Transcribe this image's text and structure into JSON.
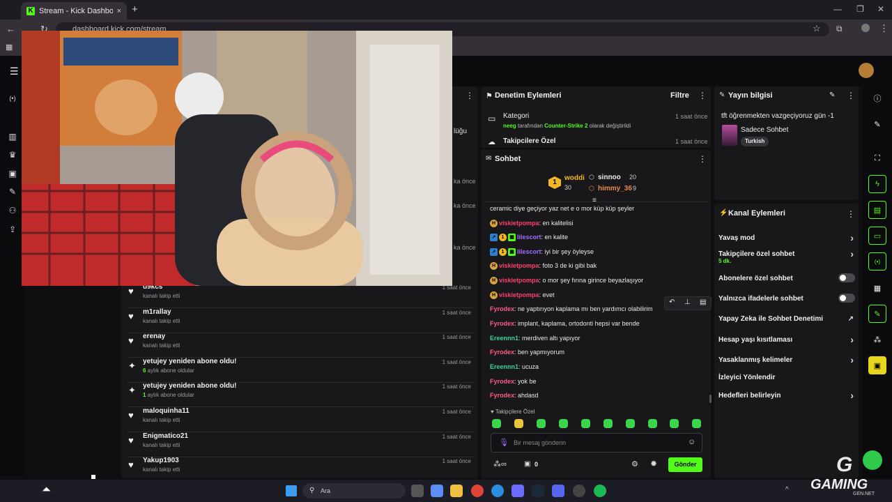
{
  "browser": {
    "tab_title": "Stream - Kick Dashboard",
    "url": "dashboard.kick.com/stream",
    "new_tab": "+",
    "tab_close": "×",
    "favicon": "K"
  },
  "left_partial": {
    "hidden_text": "lüğu",
    "times": [
      "ka önce",
      "ka önce",
      "ka önce"
    ]
  },
  "activity": [
    {
      "icon": "heart-icon",
      "glyph": "♥",
      "name": "u9kcs",
      "desc": "kanalı takip etti",
      "time": "1 saat önce"
    },
    {
      "icon": "heart-icon",
      "glyph": "♥",
      "name": "m1rallay",
      "desc": "kanalı takip etti",
      "time": "1 saat önce"
    },
    {
      "icon": "heart-icon",
      "glyph": "♥",
      "name": "erenay",
      "desc": "kanalı takip etti",
      "time": "1 saat önce"
    },
    {
      "icon": "sparkle-icon",
      "glyph": "✦",
      "name": "yetujey yeniden abone oldu!",
      "desc_num": "6",
      "desc": " aylık abone oldular",
      "time": "1 saat önce"
    },
    {
      "icon": "sparkle-icon",
      "glyph": "✦",
      "name": "yetujey yeniden abone oldu!",
      "desc_num": "1",
      "desc": " aylık abone oldular",
      "time": "1 saat önce"
    },
    {
      "icon": "heart-icon",
      "glyph": "♥",
      "name": "maloquinha11",
      "desc": "kanalı takip etti",
      "time": "1 saat önce"
    },
    {
      "icon": "heart-icon",
      "glyph": "♥",
      "name": "Enigmatico21",
      "desc": "kanalı takip etti",
      "time": "1 saat önce"
    },
    {
      "icon": "heart-icon",
      "glyph": "♥",
      "name": "Yakup1903",
      "desc": "kanalı takip etti",
      "time": "1 saat önce"
    }
  ],
  "moderation": {
    "title": "Denetim Eylemleri",
    "filter": "Filtre",
    "items": [
      {
        "title": "Kategori",
        "user": "neeg",
        "mid": " tarafından ",
        "cat": "Counter-Strike 2",
        "end": " olarak değiştirildi",
        "time": "1 saat önce"
      },
      {
        "title": "Takipcilere Özel",
        "time": "1 saat önce"
      }
    ]
  },
  "chat": {
    "title": "Sohbet",
    "leaderboard": [
      {
        "rank": "1",
        "name": "woddi",
        "count": "30"
      },
      {
        "name": "sinnoo",
        "count": "20"
      },
      {
        "name": "himmy_36",
        "count": "9"
      }
    ],
    "messages": [
      {
        "user": "",
        "text": "ceramic diye geçiyor yaz net e o mor küp küp şeyler",
        "color": "#eaeaea"
      },
      {
        "user": "viskietpompa",
        "text": ": en kalitelisi",
        "color": "#ff3d6e"
      },
      {
        "user": "lilescort",
        "text": ": en kalite",
        "color": "#a06bff"
      },
      {
        "user": "lilescort",
        "text": ": iyi bir şey öyleyse",
        "color": "#a06bff"
      },
      {
        "user": "viskietpompa",
        "text": ": foto 3 de ki gibi bak",
        "color": "#ff3d6e"
      },
      {
        "user": "viskietpompa",
        "text": ": o mor şey fırına girince beyazlaşıyor",
        "color": "#ff3d6e"
      },
      {
        "user": "viskietpompa",
        "text": ": evet",
        "color": "#ff3d6e"
      },
      {
        "user": "Fyrodex",
        "text": ": ne yaptırıyon kaplama mı ben yardımcı olabilirim",
        "color": "#ff5a8a"
      },
      {
        "user": "Fyrodex",
        "text": ": implant, kaplama, ortodonti hepsi var bende",
        "color": "#ff5a8a"
      },
      {
        "user": "Ereennn1",
        "text": ": merdiven altı yapıyor",
        "color": "#3ad39a"
      },
      {
        "user": "Fyrodex",
        "text": ": ben yapmıyorum",
        "color": "#ff5a8a"
      },
      {
        "user": "Ereennn1",
        "text": ": ucuza",
        "color": "#3ad39a"
      },
      {
        "user": "Fyrodex",
        "text": ": yok be",
        "color": "#ff5a8a"
      },
      {
        "user": "Fyrodex",
        "text": ": ahdasd",
        "color": "#ff5a8a"
      }
    ],
    "mode_label": "Takipçilere Özel",
    "placeholder": "Bir mesaj gönderin",
    "points": "0",
    "send_label": "Gönder"
  },
  "stream_info": {
    "title": "Yayın bilgisi",
    "stream_title": "tft öğrenmekten vazgeçiyoruz gün -1",
    "category": "Sadece Sohbet",
    "language": "Turkish"
  },
  "channel_actions": {
    "title": "Kanal Eylemleri",
    "items": [
      {
        "label": "Yavaş mod",
        "kind": "arrow"
      },
      {
        "label": "Takipçilere özel sohbet",
        "sub": "5 dk.",
        "kind": "arrow"
      },
      {
        "label": "Abonelere özel sohbet",
        "kind": "toggle"
      },
      {
        "label": "Yalnızca ifadelerle sohbet",
        "kind": "toggle"
      },
      {
        "label": "Yapay Zeka ile Sohbet Denetimi",
        "kind": "ext"
      },
      {
        "label": "Hesap yaşı kısıtlaması",
        "kind": "arrow"
      },
      {
        "label": "Yasaklanmış kelimeler",
        "kind": "arrow"
      },
      {
        "label": "İzleyici Yönlendir",
        "kind": "none"
      },
      {
        "label": "Hedefleri belirleyin",
        "kind": "arrow"
      }
    ]
  },
  "taskbar": {
    "search": "Ara",
    "overlay_brand": "GAMING",
    "overlay_sub": "GEN.NET",
    "overlay_letter": "G"
  },
  "colors": {
    "accent": "#53fc18",
    "panel": "#18181b",
    "bg": "#0f0f11"
  }
}
